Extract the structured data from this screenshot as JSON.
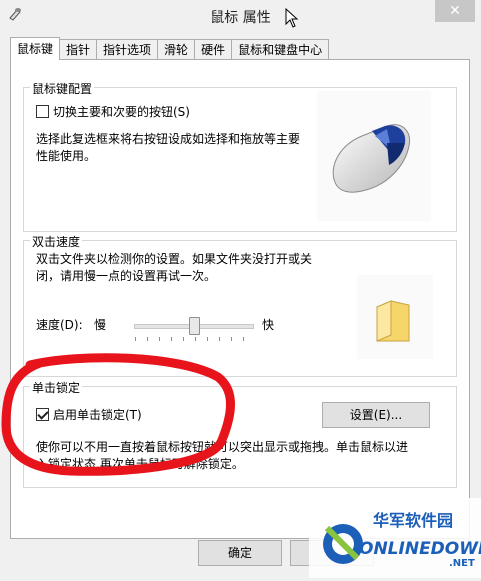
{
  "window": {
    "title": "鼠标 属性"
  },
  "tabs": [
    {
      "label": "鼠标键",
      "active": true
    },
    {
      "label": "指针",
      "active": false
    },
    {
      "label": "指针选项",
      "active": false
    },
    {
      "label": "滑轮",
      "active": false
    },
    {
      "label": "硬件",
      "active": false
    },
    {
      "label": "鼠标和键盘中心",
      "active": false
    }
  ],
  "button_config": {
    "group_title": "鼠标键配置",
    "swap_label": "切换主要和次要的按钮(S)",
    "swap_checked": false,
    "description": "选择此复选框来将右按钮设成如选择和拖放等主要性能使用。",
    "description_line1": "选择此复选框来将右按钮设成如选择和拖放等主要",
    "description_line2": "性能使用。"
  },
  "double_click": {
    "group_title": "双击速度",
    "description_line1": "双击文件夹以检测你的设置。如果文件夹没打开或关",
    "description_line2": "闭，请用慢一点的设置再试一次。",
    "speed_label": "速度(D):",
    "slow_label": "慢",
    "fast_label": "快",
    "speed_fraction": 0.5
  },
  "click_lock": {
    "group_title": "单击锁定",
    "enable_label": "启用单击锁定(T)",
    "enable_checked": true,
    "settings_button": "设置(E)...",
    "description_line1": "使你可以不用一直按着鼠标按钮就可以突出显示或拖拽。单击鼠标以进",
    "description_line2": "入锁定状态,再次单击鼠标可解除锁定。"
  },
  "footer": {
    "ok_button": "确定"
  },
  "watermark": {
    "brand_cn": "华军软件园",
    "brand_en": "ONLINEDOWN",
    "suffix": ".NET"
  },
  "colors": {
    "annotation": "#e8141b",
    "watermark_blue": "#1b5fb8"
  }
}
